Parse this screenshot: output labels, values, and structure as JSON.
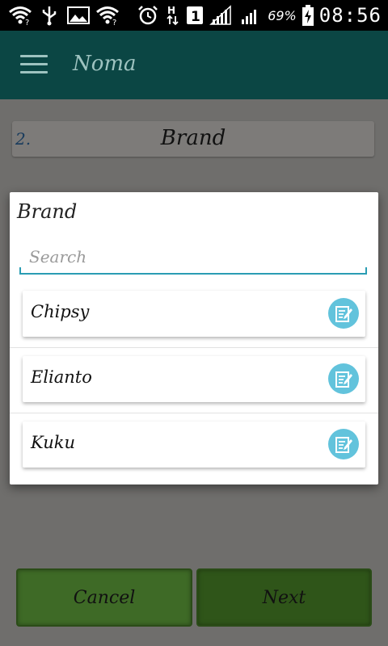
{
  "status_bar": {
    "battery_percent": "69%",
    "time": "08:56",
    "sim_slot": "1",
    "network_letter": "H",
    "icons": [
      "wifi-question-icon",
      "usb-icon",
      "image-icon",
      "wifi-question-icon",
      "alarm-icon",
      "data-transfer-icon",
      "sim-1-icon",
      "signal-icon",
      "signal-icon",
      "battery-charging-icon"
    ]
  },
  "app_bar": {
    "title": "Noma",
    "menu_icon": "hamburger-menu-icon"
  },
  "form": {
    "field_number": "2.",
    "field_label": "Brand"
  },
  "dialog": {
    "title": "Brand",
    "search": {
      "placeholder": "Search",
      "value": ""
    },
    "items": [
      {
        "label": "Chipsy",
        "icon": "edit-icon"
      },
      {
        "label": "Elianto",
        "icon": "edit-icon"
      },
      {
        "label": "Kuku",
        "icon": "edit-icon"
      }
    ]
  },
  "buttons": {
    "cancel_label": "Cancel",
    "next_label": "Next"
  },
  "colors": {
    "app_bar": "#0b4644",
    "accent": "#2a9db3",
    "edit_icon_bg": "#62c3dc",
    "button_green": "#3e6a26"
  }
}
